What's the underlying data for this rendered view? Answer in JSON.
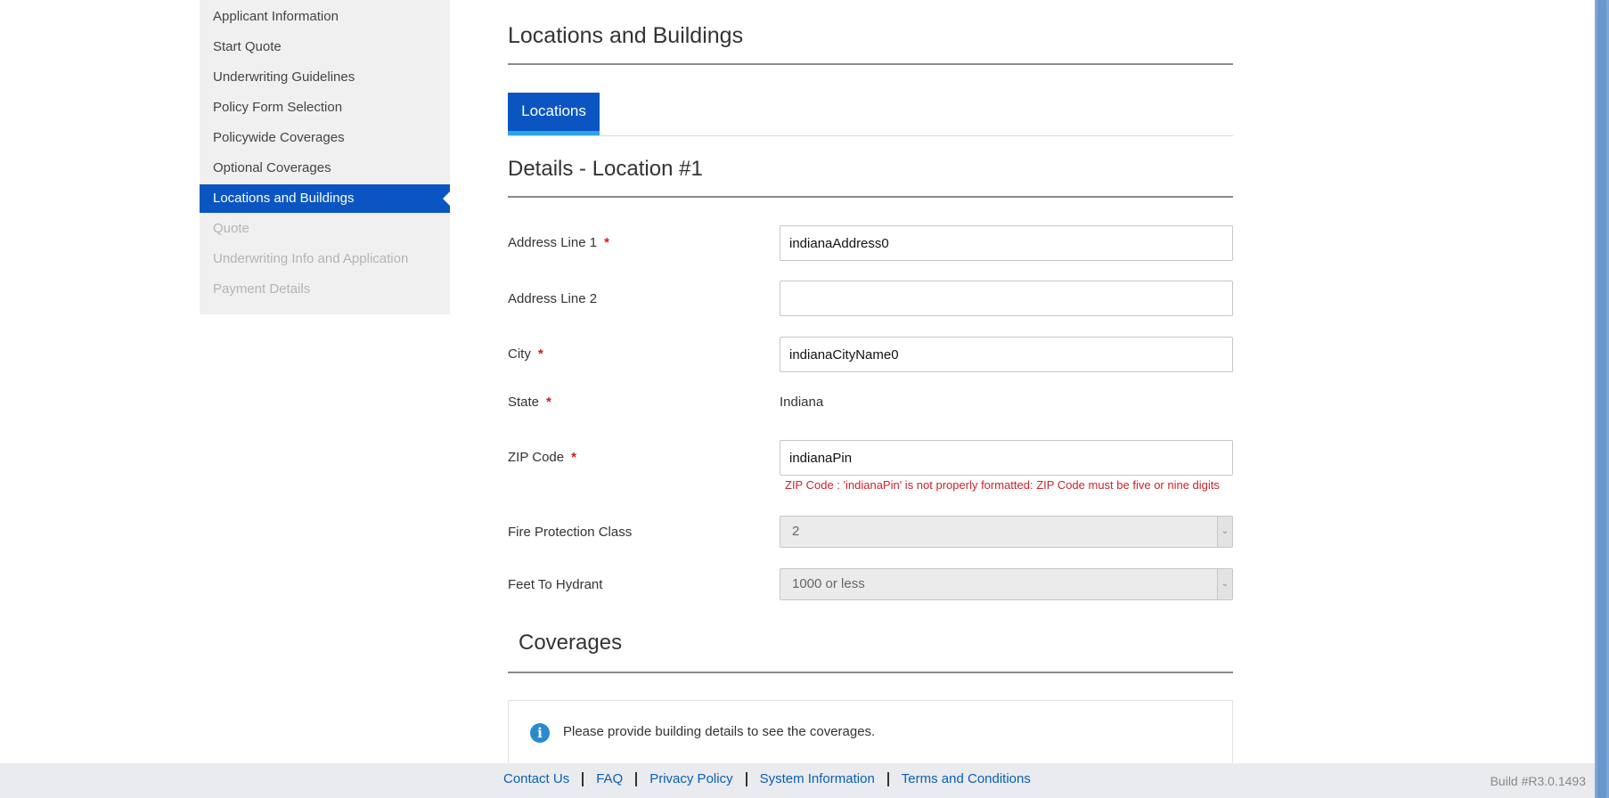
{
  "sidebar": {
    "items": [
      {
        "label": "Applicant Information",
        "state": "normal"
      },
      {
        "label": "Start Quote",
        "state": "normal"
      },
      {
        "label": "Underwriting Guidelines",
        "state": "normal"
      },
      {
        "label": "Policy Form Selection",
        "state": "normal"
      },
      {
        "label": "Policywide Coverages",
        "state": "normal"
      },
      {
        "label": "Optional Coverages",
        "state": "normal"
      },
      {
        "label": "Locations and Buildings",
        "state": "active"
      },
      {
        "label": "Quote",
        "state": "disabled"
      },
      {
        "label": "Underwriting Info and Application",
        "state": "disabled"
      },
      {
        "label": "Payment Details",
        "state": "disabled"
      }
    ]
  },
  "main": {
    "title": "Locations and Buildings",
    "tab_label": "Locations",
    "details_title": "Details - Location #1",
    "fields": {
      "address1": {
        "label": "Address Line 1",
        "value": "indianaAddress0",
        "required": "*"
      },
      "address2": {
        "label": "Address Line 2",
        "value": ""
      },
      "city": {
        "label": "City",
        "value": "indianaCityName0",
        "required": "*"
      },
      "state": {
        "label": "State",
        "value": "Indiana",
        "required": "*"
      },
      "zip": {
        "label": "ZIP Code",
        "value": "indianaPin",
        "required": "*",
        "error": "ZIP Code : 'indianaPin' is not properly formatted: ZIP Code must be five or nine digits"
      },
      "fire_class": {
        "label": "Fire Protection Class",
        "value": "2"
      },
      "hydrant": {
        "label": "Feet To Hydrant",
        "value": "1000 or less"
      }
    },
    "coverages_title": "Coverages",
    "coverages_info": "Please provide building details to see the coverages."
  },
  "footer": {
    "links": [
      "Contact Us",
      "FAQ",
      "Privacy Policy",
      "System Information",
      "Terms and Conditions"
    ],
    "build": "Build #R3.0.1493"
  },
  "colors": {
    "accent": "#0b55c3",
    "tab_underline": "#2aa4e2",
    "error": "#c9252c",
    "required": "#d01d1d",
    "link": "#0b5fb3"
  },
  "icons": {
    "info": "info-circle-icon",
    "select_arrow": "chevron-down-icon"
  }
}
